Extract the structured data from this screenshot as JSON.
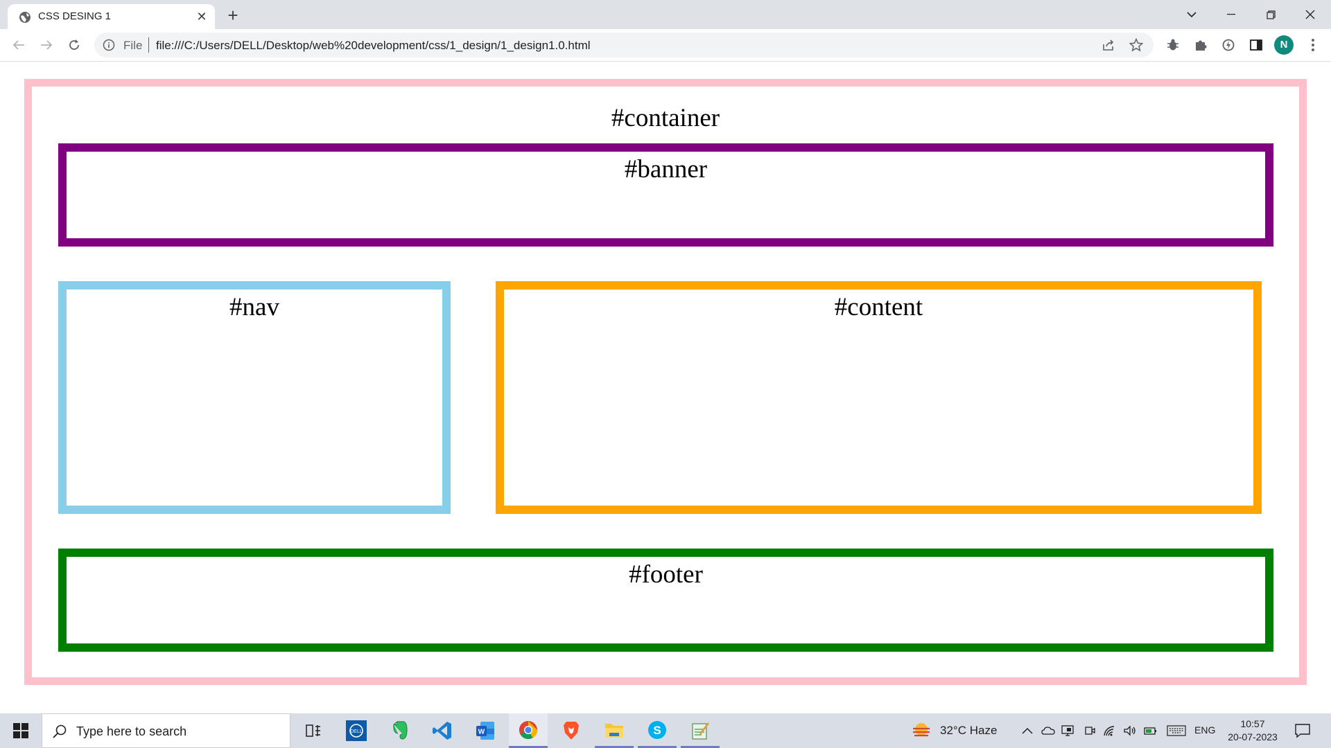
{
  "browser": {
    "tab_title": "CSS DESING 1",
    "omnibox_scheme": "File",
    "url": "file:///C:/Users/DELL/Desktop/web%20development/css/1_design/1_design1.0.html",
    "profile_initial": "N"
  },
  "page": {
    "container_label": "#container",
    "banner_label": "#banner",
    "nav_label": "#nav",
    "content_label": "#content",
    "footer_label": "#footer",
    "colors": {
      "container_border": "#ffc0cb",
      "banner_border": "#800080",
      "nav_border": "#87ceeb",
      "content_border": "#ffa500",
      "footer_border": "#008000"
    }
  },
  "taskbar": {
    "search_placeholder": "Type here to search",
    "apps": [
      "task-view",
      "dell",
      "evernote",
      "vscode",
      "word",
      "chrome",
      "brave",
      "file-explorer",
      "skype",
      "notepad"
    ],
    "weather": "32°C  Haze",
    "language": "ENG",
    "time": "10:57",
    "date": "20-07-2023"
  }
}
